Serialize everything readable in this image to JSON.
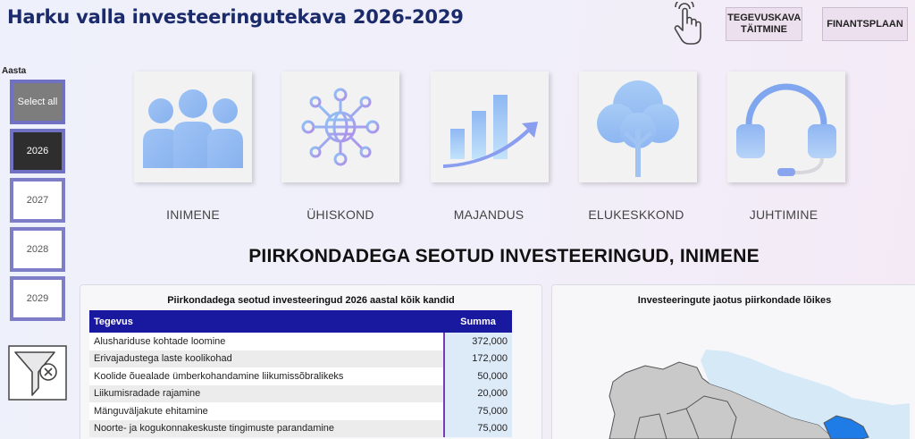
{
  "header": {
    "title": "Harku valla investeeringutekava 2026-2029",
    "buttons": {
      "tegevuskava": "TEGEVUSKAVA TÄITMINE",
      "finantsplaan": "FINANTSPLAAN"
    }
  },
  "sidebar": {
    "label": "Aasta",
    "years": [
      {
        "label": "Select all",
        "state": "all"
      },
      {
        "label": "2026",
        "state": "selected"
      },
      {
        "label": "2027",
        "state": "normal"
      },
      {
        "label": "2028",
        "state": "normal"
      },
      {
        "label": "2029",
        "state": "normal"
      }
    ]
  },
  "categories": [
    {
      "label": "INIMENE",
      "icon": "people-icon"
    },
    {
      "label": "ÜHISKOND",
      "icon": "network-globe-icon"
    },
    {
      "label": "MAJANDUS",
      "icon": "growth-chart-icon"
    },
    {
      "label": "ELUKESKKOND",
      "icon": "tree-icon"
    },
    {
      "label": "JUHTIMINE",
      "icon": "headset-icon"
    }
  ],
  "section": {
    "title": "PIIRKONDADEGA SEOTUD INVESTEERINGUD, INIMENE"
  },
  "table_panel": {
    "title": "Piirkondadega seotud investeeringud 2026 aastal kõik kandid",
    "columns": [
      "Tegevus",
      "Summa"
    ],
    "rows": [
      {
        "tegevus": "Alushariduse kohtade loomine",
        "summa": "372,000"
      },
      {
        "tegevus": "Erivajadustega laste koolikohad",
        "summa": "172,000"
      },
      {
        "tegevus": "Koolide õuealade ümberkohandamine liikumissõbralikeks",
        "summa": "50,000"
      },
      {
        "tegevus": "Liikumisradade rajamine",
        "summa": "20,000"
      },
      {
        "tegevus": "Mänguväljakute ehitamine",
        "summa": "75,000"
      },
      {
        "tegevus": "Noorte- ja kogukonnakeskuste tingimuste parandamine",
        "summa": "75,000"
      }
    ]
  },
  "map_panel": {
    "title": "Investeeringute jaotus piirkondade lõikes"
  },
  "colors": {
    "accent": "#1919a0",
    "title": "#1b2a6b",
    "year_border": "#7e7ec8"
  }
}
